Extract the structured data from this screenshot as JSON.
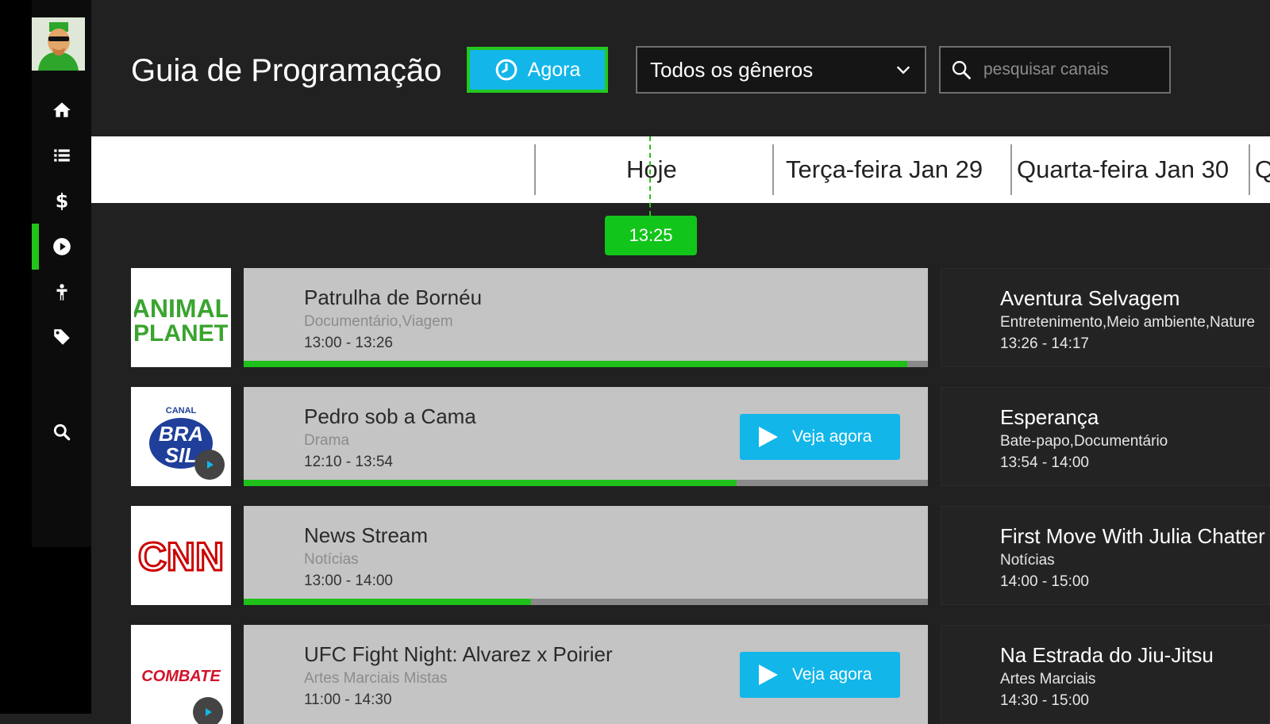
{
  "header": {
    "title": "Guia de Programação",
    "now_button": "Agora",
    "genre_select": "Todos os gêneros",
    "search_placeholder": "pesquisar canais"
  },
  "sidebar": {
    "items": [
      {
        "icon": "home-icon"
      },
      {
        "icon": "list-icon"
      },
      {
        "icon": "dollar-icon"
      },
      {
        "icon": "play-circle-icon",
        "active": true
      },
      {
        "icon": "person-icon"
      },
      {
        "icon": "tag-icon"
      },
      {
        "icon": "search-icon"
      }
    ]
  },
  "dates": [
    "Hoje",
    "Terça-feira Jan 29",
    "Quarta-feira Jan 30",
    "Q"
  ],
  "current_time": "13:25",
  "colors": {
    "accent_green": "#22c31a",
    "accent_blue": "#12b6e9",
    "background": "#212121"
  },
  "channels": [
    {
      "logo": "ANIMAL PLANET",
      "current": {
        "title": "Patrulha de Bornéu",
        "genre": "Documentário,Viagem",
        "time": "13:00 - 13:26",
        "progress": 0.97
      },
      "next": {
        "title": "Aventura Selvagem",
        "genre": "Entretenimento,Meio ambiente,Nature",
        "time": "13:26 - 14:17"
      }
    },
    {
      "logo": "CANAL BRASIL",
      "logo_small": "CANAL",
      "logo_big_1": "BRA",
      "logo_big_2": "SIL",
      "current": {
        "title": "Pedro sob a Cama",
        "genre": "Drama",
        "time": "12:10 - 13:54",
        "progress": 0.72,
        "watch_label": "Veja agora"
      },
      "next": {
        "title": "Esperança",
        "genre": "Bate-papo,Documentário",
        "time": "13:54 - 14:00"
      }
    },
    {
      "logo": "CNN",
      "current": {
        "title": "News Stream",
        "genre": "Notícias",
        "time": "13:00 - 14:00",
        "progress": 0.42
      },
      "next": {
        "title": "First Move With Julia Chatter",
        "genre": "Notícias",
        "time": "14:00 - 15:00"
      }
    },
    {
      "logo": "COMBATE",
      "current": {
        "title": "UFC Fight Night: Alvarez x Poirier",
        "genre": "Artes Marciais Mistas",
        "time": "11:00 - 14:30",
        "watch_label": "Veja agora"
      },
      "next": {
        "title": "Na Estrada do Jiu-Jitsu",
        "genre": "Artes Marciais",
        "time": "14:30 - 15:00"
      }
    }
  ]
}
